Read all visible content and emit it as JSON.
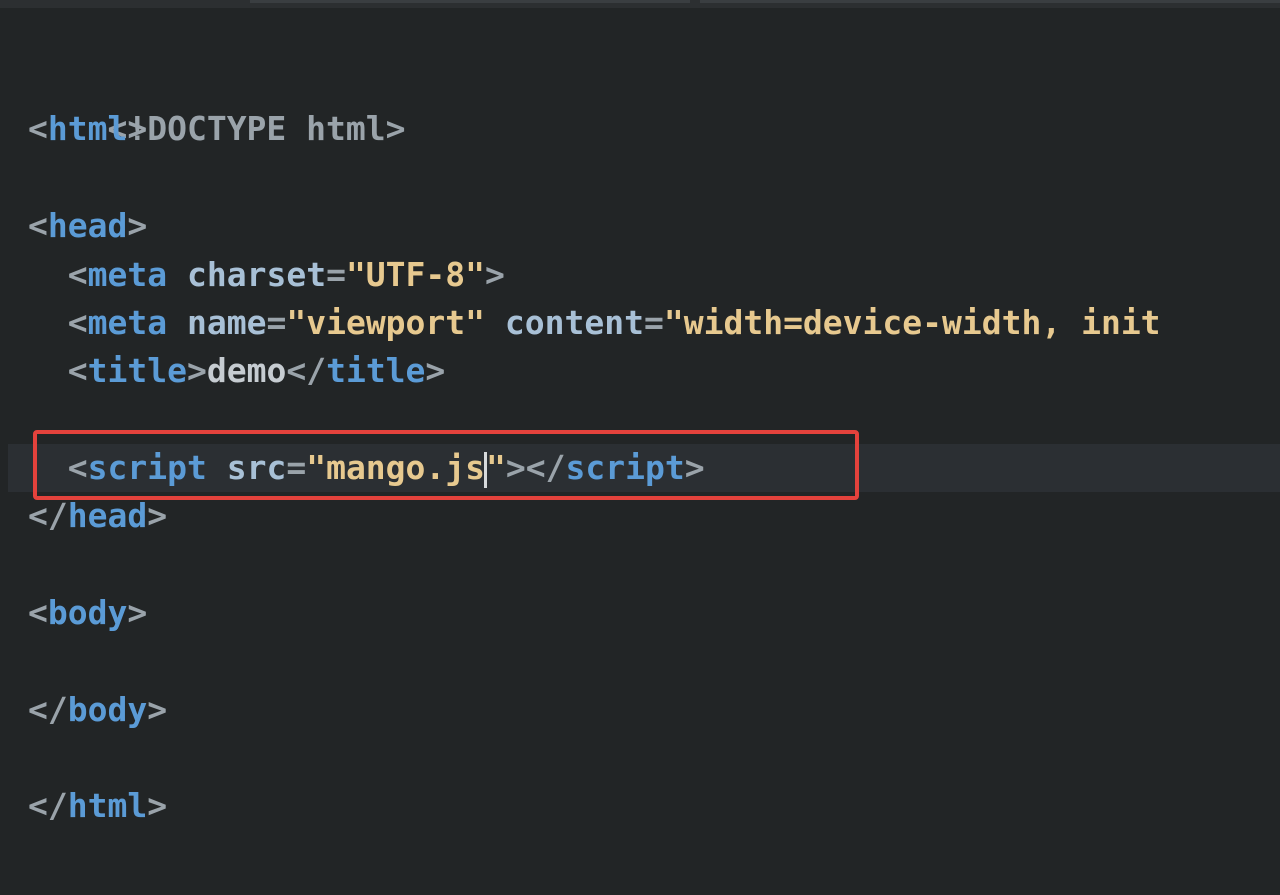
{
  "editor": {
    "doctype": "<!DOCTYPE html>",
    "html_tag": "html",
    "head_tag": "head",
    "meta_tag": "meta",
    "charset_attr": "charset",
    "charset_value": "\"UTF-8\"",
    "name_attr": "name",
    "name_value": "\"viewport\"",
    "content_attr": "content",
    "content_value_visible": "\"width=device-width, init",
    "title_tag": "title",
    "title_text": "demo",
    "script_tag": "script",
    "src_attr": "src",
    "src_value_before_caret": "\"mango.js",
    "src_value_after_caret": "\"",
    "body_tag": "body"
  },
  "colors": {
    "background": "#222526",
    "tag": "#5b9bd6",
    "punctuation": "#9aa3aa",
    "attribute": "#a8c0d6",
    "string": "#e7c98f",
    "highlight_border": "#e4423c"
  }
}
